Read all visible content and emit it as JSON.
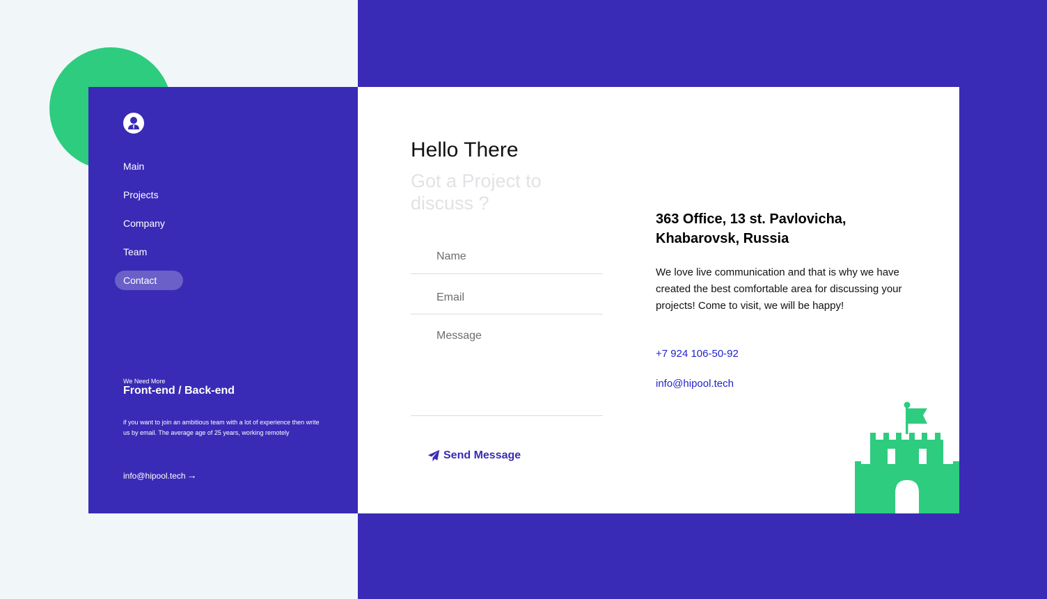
{
  "nav": {
    "items": [
      {
        "label": "Main"
      },
      {
        "label": "Projects"
      },
      {
        "label": "Company"
      },
      {
        "label": "Team"
      },
      {
        "label": "Contact"
      }
    ],
    "active_index": 4
  },
  "hiring": {
    "small": "We Need More",
    "title": "Front-end / Back-end",
    "text": "if you want to join an ambitious team with a lot of experience then write us by email. The average age of 25 years, working remotely",
    "email": "info@hipool.tech"
  },
  "main": {
    "title": "Hello There",
    "subtitle": "Got a Project to discuss ?"
  },
  "form": {
    "name_placeholder": "Name",
    "email_placeholder": "Email",
    "message_placeholder": "Message",
    "send_label": "Send Message"
  },
  "contact": {
    "address": "363 Office, 13 st. Pavlovicha, Khabarovsk, Russia",
    "about": "We love live communication and that is why we have created the best comfortable area for discussing your projects! Come to visit, we will be happy!",
    "phone": "+7 924 106-50-92",
    "email": "info@hipool.tech"
  },
  "colors": {
    "primary": "#392bb5",
    "accent_green": "#2ecc7e",
    "page_bg": "#f1f6f9",
    "link": "#2222cc"
  },
  "icons": [
    "user-avatar-icon",
    "arrow-right-icon",
    "paper-plane-icon",
    "castle-illustration"
  ]
}
